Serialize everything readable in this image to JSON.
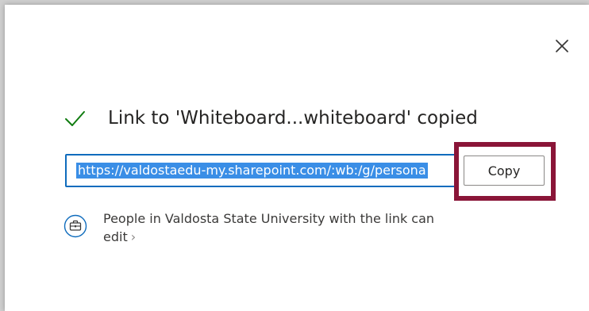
{
  "dialog": {
    "title": "Link to 'Whiteboard...whiteboard' copied",
    "link_value": "https://valdostaedu-my.sharepoint.com/:wb:/g/persona",
    "copy_label": "Copy",
    "permission_text": "People in Valdosta State University with the link can edit",
    "icons": {
      "close": "close-icon",
      "success": "checkmark-icon",
      "permission": "briefcase-icon",
      "more": "chevron-right-icon"
    }
  },
  "colors": {
    "accent": "#0f6cbd",
    "selection": "#3a8ee6",
    "success": "#107c10",
    "highlight_frame": "#8a1538"
  }
}
